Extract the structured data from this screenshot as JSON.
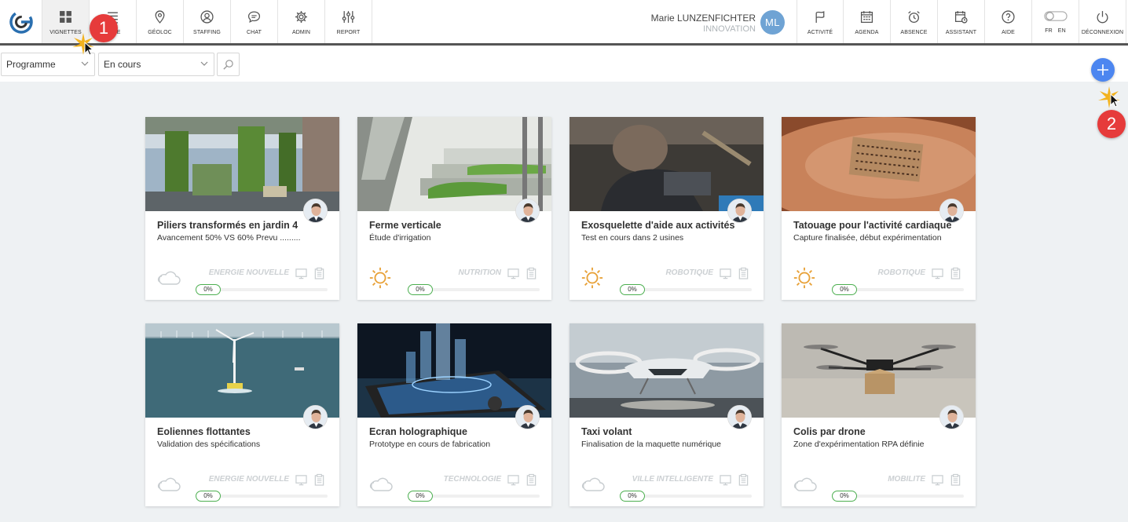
{
  "nav": {
    "left": [
      {
        "label": "VIGNETTES",
        "icon": "grid-icon"
      },
      {
        "label": "LISTE",
        "icon": "list-icon"
      },
      {
        "label": "GÉOLOC",
        "icon": "map-pin-icon"
      },
      {
        "label": "STAFFING",
        "icon": "user-circle-icon"
      },
      {
        "label": "CHAT",
        "icon": "chat-icon"
      },
      {
        "label": "ADMIN",
        "icon": "gear-icon"
      },
      {
        "label": "REPORT",
        "icon": "sliders-icon"
      }
    ],
    "right": [
      {
        "label": "ACTIVITÉ",
        "icon": "flag-icon"
      },
      {
        "label": "AGENDA",
        "icon": "calendar-icon"
      },
      {
        "label": "ABSENCE",
        "icon": "alarm-icon"
      },
      {
        "label": "ASSISTANT",
        "icon": "calendar-clock-icon"
      },
      {
        "label": "AIDE",
        "icon": "help-icon"
      },
      {
        "label_fr": "FR",
        "label_en": "EN",
        "icon": "toggle-icon"
      },
      {
        "label": "DÉCONNEXION",
        "icon": "power-icon"
      }
    ]
  },
  "user": {
    "name": "Marie LUNZENFICHTER",
    "org": "INNOVATION",
    "initials": "ML",
    "avatar_color": "#6fa3d4"
  },
  "filters": {
    "program": "Programme",
    "status": "En cours"
  },
  "colors": {
    "accent": "#4c86f0",
    "badge": "#e63b3b",
    "progress": "#4caf50",
    "sun": "#e8a23a"
  },
  "badges": {
    "one": "1",
    "two": "2"
  },
  "cards": [
    {
      "title": "Piliers transformés en jardin 4",
      "subtitle": "Avancement 50% VS 60% Prevu .........",
      "category": "ENERGIE NOUVELLE",
      "weather": "cloud-icon",
      "progress": "0%"
    },
    {
      "title": "Ferme verticale",
      "subtitle": "Étude d'irrigation",
      "category": "NUTRITION",
      "weather": "sun-icon",
      "progress": "0%"
    },
    {
      "title": "Exosquelette d'aide aux activités",
      "subtitle": "Test en cours dans 2 usines",
      "category": "ROBOTIQUE",
      "weather": "sun-icon",
      "progress": "0%"
    },
    {
      "title": "Tatouage pour l'activité cardiaque",
      "subtitle": "Capture finalisée, début expérimentation",
      "category": "ROBOTIQUE",
      "weather": "sun-icon",
      "progress": "0%"
    },
    {
      "title": "Eoliennes flottantes",
      "subtitle": "Validation des spécifications",
      "category": "ENERGIE NOUVELLE",
      "weather": "cloud-icon",
      "progress": "0%"
    },
    {
      "title": "Ecran holographique",
      "subtitle": "Prototype en cours de fabrication",
      "category": "TECHNOLOGIE",
      "weather": "cloud-icon",
      "progress": "0%"
    },
    {
      "title": "Taxi volant",
      "subtitle": "Finalisation de la maquette numérique",
      "category": "VILLE INTELLIGENTE",
      "weather": "cloud-icon",
      "progress": "0%"
    },
    {
      "title": "Colis par drone",
      "subtitle": "Zone d'expérimentation RPA définie",
      "category": "MOBILITE",
      "weather": "cloud-icon",
      "progress": "0%"
    }
  ]
}
